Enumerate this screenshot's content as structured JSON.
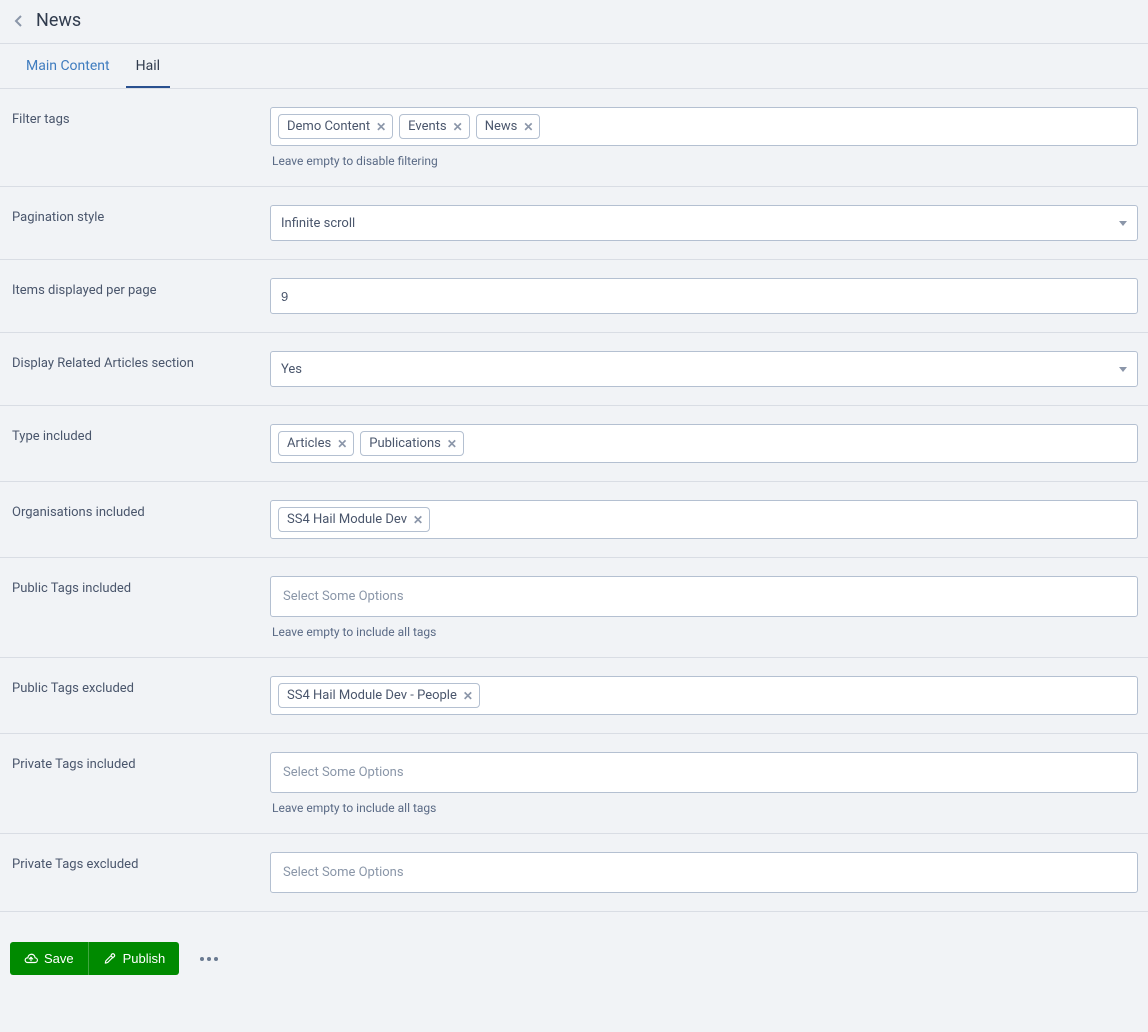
{
  "header": {
    "title": "News"
  },
  "tabs": [
    {
      "label": "Main Content",
      "active": false
    },
    {
      "label": "Hail",
      "active": true
    }
  ],
  "fields": {
    "filter_tags": {
      "label": "Filter tags",
      "chips": [
        "Demo Content",
        "Events",
        "News"
      ],
      "help": "Leave empty to disable filtering"
    },
    "pagination_style": {
      "label": "Pagination style",
      "value": "Infinite scroll"
    },
    "items_per_page": {
      "label": "Items displayed per page",
      "value": "9"
    },
    "display_related": {
      "label": "Display Related Articles section",
      "value": "Yes"
    },
    "type_included": {
      "label": "Type included",
      "chips": [
        "Articles",
        "Publications"
      ]
    },
    "orgs_included": {
      "label": "Organisations included",
      "chips": [
        "SS4 Hail Module Dev"
      ]
    },
    "public_tags_included": {
      "label": "Public Tags included",
      "placeholder": "Select Some Options",
      "help": "Leave empty to include all tags"
    },
    "public_tags_excluded": {
      "label": "Public Tags excluded",
      "chips": [
        "SS4 Hail Module Dev - People"
      ]
    },
    "private_tags_included": {
      "label": "Private Tags included",
      "placeholder": "Select Some Options",
      "help": "Leave empty to include all tags"
    },
    "private_tags_excluded": {
      "label": "Private Tags excluded",
      "placeholder": "Select Some Options"
    }
  },
  "actions": {
    "save": "Save",
    "publish": "Publish"
  }
}
